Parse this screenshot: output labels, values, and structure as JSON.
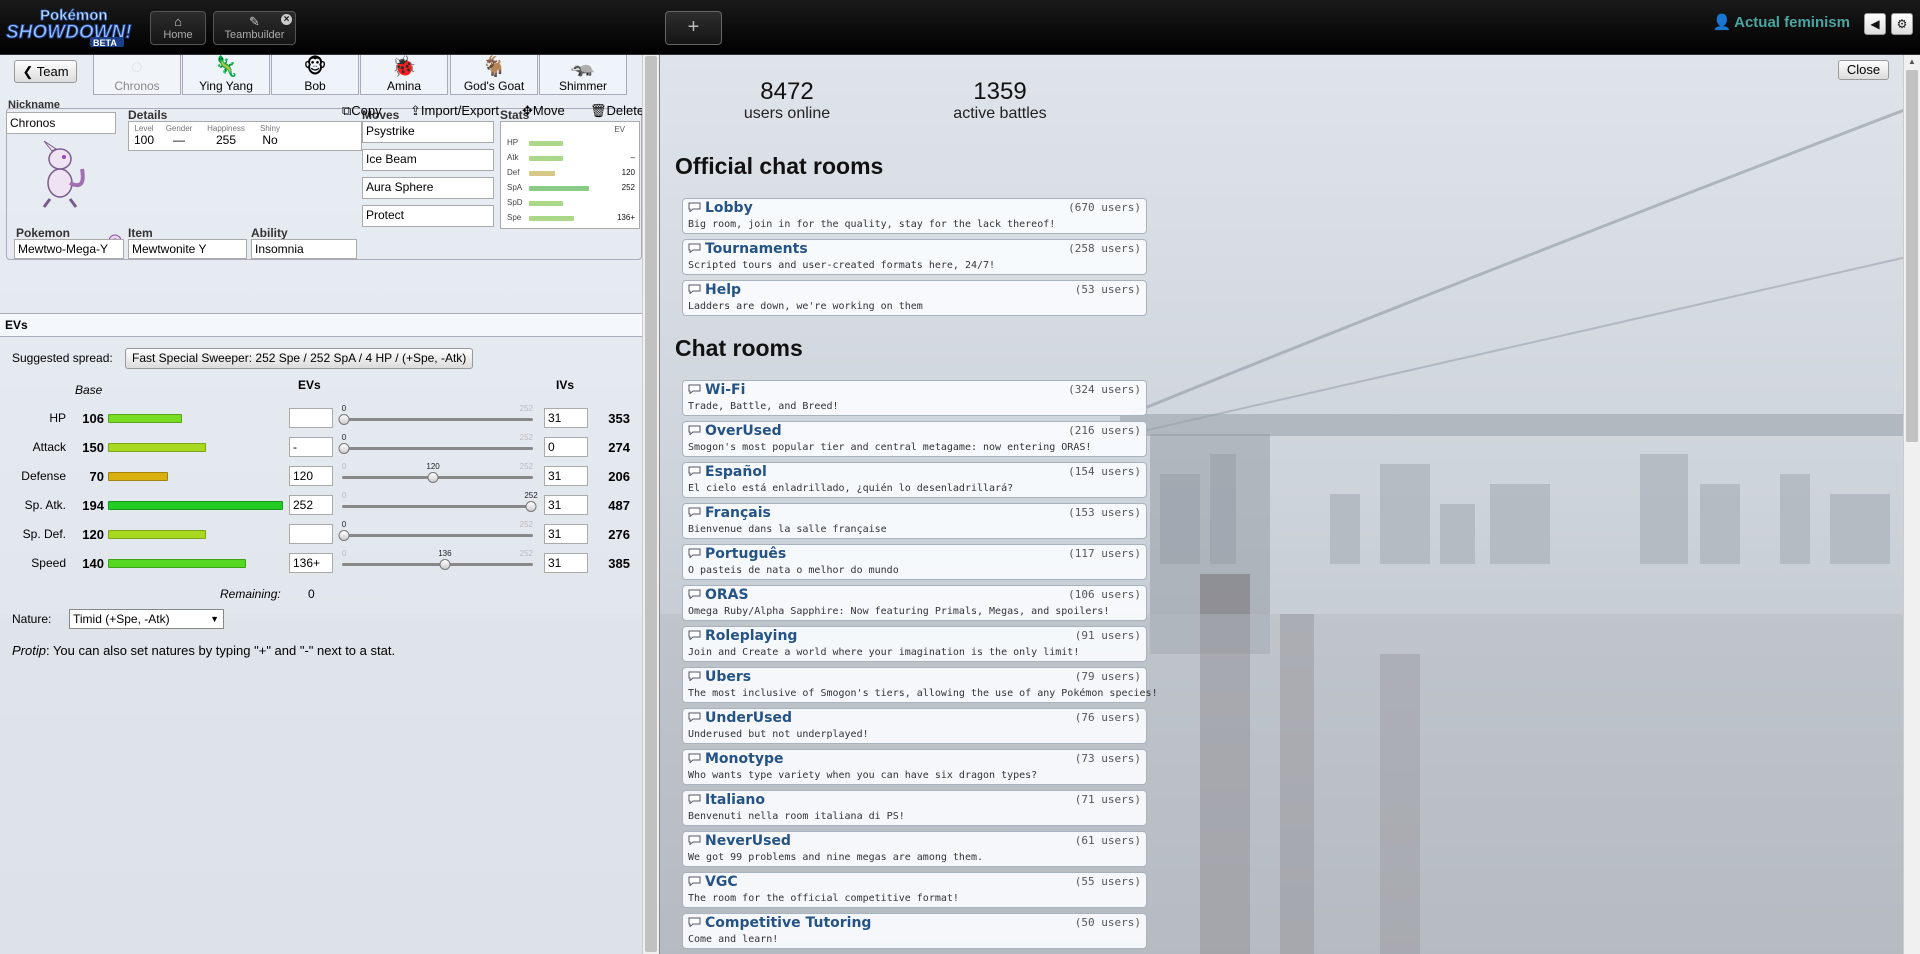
{
  "header": {
    "logo_text": "Pokémon Showdown! BETA",
    "home_label": "Home",
    "teambuilder_label": "Teambuilder",
    "new_tab_symbol": "+",
    "username": "Actual feminism"
  },
  "team_button": "Team",
  "team_tabs": [
    {
      "name": "Chronos",
      "active": true
    },
    {
      "name": "Ying Yang"
    },
    {
      "name": "Bob"
    },
    {
      "name": "Amina"
    },
    {
      "name": "God's Goat"
    },
    {
      "name": "Shimmer"
    }
  ],
  "set": {
    "nickname_label": "Nickname",
    "nickname": "Chronos",
    "details_label": "Details",
    "details": [
      {
        "label": "Level",
        "value": "100"
      },
      {
        "label": "Gender",
        "value": "—"
      },
      {
        "label": "Happiness",
        "value": "255"
      },
      {
        "label": "Shiny",
        "value": "No"
      }
    ],
    "pokemon_label": "Pokemon",
    "pokemon": "Mewtwo-Mega-Y",
    "item_label": "Item",
    "item": "Mewtwonite Y",
    "ability_label": "Ability",
    "ability": "Insomnia",
    "moves_label": "Moves",
    "moves": [
      "Psystrike",
      "Ice Beam",
      "Aura Sphere",
      "Protect"
    ],
    "stats_label": "Stats",
    "stats_ev_header": "EV",
    "stats_mini": [
      {
        "name": "HP",
        "ev": "",
        "fill": 0.45
      },
      {
        "name": "Atk",
        "ev": "–",
        "fill": 0.45
      },
      {
        "name": "Def",
        "ev": "120",
        "fill": 0.35
      },
      {
        "name": "SpA",
        "ev": "252",
        "fill": 0.8
      },
      {
        "name": "SpD",
        "ev": "",
        "fill": 0.45
      },
      {
        "name": "Spe",
        "ev": "136+",
        "fill": 0.6
      }
    ],
    "actions": {
      "copy": "Copy",
      "import_export": "Import/Export",
      "move": "Move",
      "delete": "Delete"
    }
  },
  "evs": {
    "title": "EVs",
    "suggested_label": "Suggested spread:",
    "suggested_value": "Fast Special Sweeper: 252 Spe / 252 SpA / 4 HP / (+Spe, -Atk)",
    "base_header": "Base",
    "evs_header": "EVs",
    "ivs_header": "IVs",
    "slider_min": "0",
    "slider_max": "252",
    "rows": [
      {
        "label": "HP",
        "base": "106",
        "bar_fill": 0.42,
        "bar_color": "#77dd22",
        "ev": "",
        "slider": 0,
        "slider_label": "0",
        "iv": "31",
        "total": "353"
      },
      {
        "label": "Attack",
        "base": "150",
        "bar_fill": 0.56,
        "bar_color": "#a8d820",
        "ev": "-",
        "slider": 0,
        "slider_label": "0",
        "iv": "0",
        "total": "274"
      },
      {
        "label": "Defense",
        "base": "70",
        "bar_fill": 0.34,
        "bar_color": "#d8b010",
        "ev": "120",
        "slider": 120,
        "slider_label": "120",
        "iv": "31",
        "total": "206"
      },
      {
        "label": "Sp. Atk.",
        "base": "194",
        "bar_fill": 1.0,
        "bar_color": "#22cc22",
        "ev": "252",
        "slider": 252,
        "slider_label": "252",
        "iv": "31",
        "total": "487"
      },
      {
        "label": "Sp. Def.",
        "base": "120",
        "bar_fill": 0.56,
        "bar_color": "#a8d820",
        "ev": "",
        "slider": 0,
        "slider_label": "0",
        "iv": "31",
        "total": "276"
      },
      {
        "label": "Speed",
        "base": "140",
        "bar_fill": 0.79,
        "bar_color": "#55d822",
        "ev": "136+",
        "slider": 136,
        "slider_label": "136",
        "iv": "31",
        "total": "385"
      }
    ],
    "remaining_label": "Remaining:",
    "remaining_value": "0",
    "nature_label": "Nature:",
    "nature_value": "Timid (+Spe, -Atk)",
    "protip_label": "Protip",
    "protip_text": ": You can also set natures by typing \"+\" and \"-\" next to a stat."
  },
  "main": {
    "users_online": "8472",
    "users_online_label": "users online",
    "active_battles": "1359",
    "active_battles_label": "active battles",
    "close_label": "Close",
    "official_heading": "Official chat rooms",
    "official_rooms": [
      {
        "name": "Lobby",
        "users": "(670 users)",
        "desc": "Big room, join in for the quality, stay for the lack thereof!"
      },
      {
        "name": "Tournaments",
        "users": "(258 users)",
        "desc": "Scripted tours and user-created formats here, 24/7!"
      },
      {
        "name": "Help",
        "users": "(53 users)",
        "desc": "Ladders are down, we're working on them"
      }
    ],
    "chat_heading": "Chat rooms",
    "chat_rooms": [
      {
        "name": "Wi-Fi",
        "users": "(324 users)",
        "desc": "Trade, Battle, and Breed!"
      },
      {
        "name": "OverUsed",
        "users": "(216 users)",
        "desc": "Smogon's most popular tier and central metagame: now entering ORAS!"
      },
      {
        "name": "Español",
        "users": "(154 users)",
        "desc": "El cielo está enladrillado, ¿quién lo desenladrillará?"
      },
      {
        "name": "Français",
        "users": "(153 users)",
        "desc": "Bienvenue dans la salle française"
      },
      {
        "name": "Português",
        "users": "(117 users)",
        "desc": "O pasteis de nata o melhor do mundo"
      },
      {
        "name": "ORAS",
        "users": "(106 users)",
        "desc": "Omega Ruby/Alpha Sapphire: Now featuring Primals, Megas, and spoilers!"
      },
      {
        "name": "Roleplaying",
        "users": "(91 users)",
        "desc": "Join and Create a world where your imagination is the only limit!"
      },
      {
        "name": "Ubers",
        "users": "(79 users)",
        "desc": "The most inclusive of Smogon's tiers, allowing the use of any Pokémon species!"
      },
      {
        "name": "UnderUsed",
        "users": "(76 users)",
        "desc": "Underused but not underplayed!"
      },
      {
        "name": "Monotype",
        "users": "(73 users)",
        "desc": "Who wants type variety when you can have six dragon types?"
      },
      {
        "name": "Italiano",
        "users": "(71 users)",
        "desc": "Benvenuti nella room italiana di PS!"
      },
      {
        "name": "NeverUsed",
        "users": "(61 users)",
        "desc": "We got 99 problems and nine megas are among them."
      },
      {
        "name": "VGC",
        "users": "(55 users)",
        "desc": "The room for the official competitive format!"
      },
      {
        "name": "Competitive Tutoring",
        "users": "(50 users)",
        "desc": "Come and learn!"
      }
    ]
  }
}
